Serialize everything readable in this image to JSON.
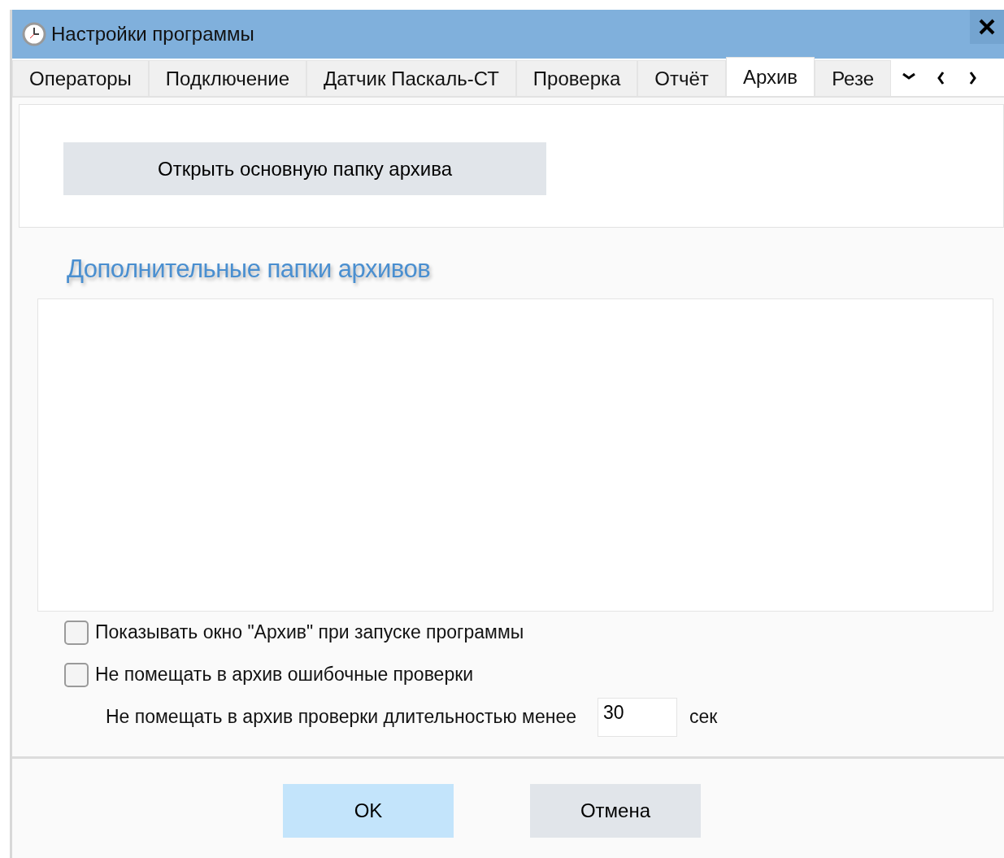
{
  "window": {
    "title": "Настройки программы"
  },
  "tabs": [
    {
      "label": "Операторы",
      "selected": false
    },
    {
      "label": "Подключение",
      "selected": false
    },
    {
      "label": "Датчик Паскаль-СТ",
      "selected": false
    },
    {
      "label": "Проверка",
      "selected": false
    },
    {
      "label": "Отчёт",
      "selected": false
    },
    {
      "label": "Архив",
      "selected": true
    },
    {
      "label": "Резе",
      "selected": false
    }
  ],
  "open_folder_button": "Открыть основную папку архива",
  "additional_folders": {
    "heading": "Дополнительные папки архивов"
  },
  "options": [
    {
      "label": "Показывать окно \"Архив\" при запуске программы",
      "checked": false
    },
    {
      "label": "Не помещать в архив ошибочные проверки",
      "checked": false
    }
  ],
  "min_duration": {
    "label": "Не помещать в архив проверки длительностью менее",
    "value": "30",
    "unit": "сек"
  },
  "buttons": [
    {
      "label": "OK",
      "kind": "primary"
    },
    {
      "label": "Отмена",
      "kind": "secondary"
    }
  ]
}
